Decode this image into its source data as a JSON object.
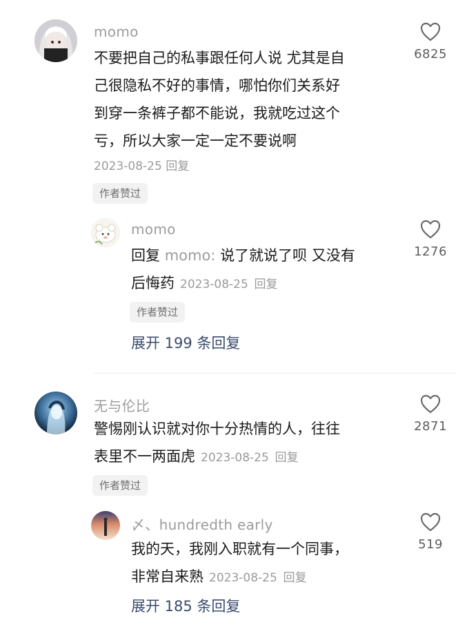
{
  "icons": {
    "like": "heart-outline-icon"
  },
  "colors": {
    "text": "#1a1a1a",
    "muted": "#9a9a9a",
    "link": "#3a4a6c",
    "badge_bg": "#f2f2f2"
  },
  "comments": [
    {
      "username": "momo",
      "text": "不要把自己的私事跟任何人说 尤其是自己很隐私不好的事情，哪怕你们关系好到穿一条裤子都不能说，我就吃过这个亏，所以大家一定一定不要说啊",
      "lines": [
        "不要把自己的私事跟任何人说 尤其是自",
        "己很隐私不好的事情，哪怕你们关系好",
        "到穿一条裤子都不能说，我就吃过这个",
        "亏，所以大家一定一定不要说啊"
      ],
      "date": "2023-08-25",
      "reply_label": "回复",
      "badge": "作者赞过",
      "likes": "6825",
      "reply": {
        "username": "momo",
        "prefix": "回复",
        "reply_to": "momo:",
        "line1": "说了就说了呗 又没有",
        "line2": "后悔药",
        "date": "2023-08-25",
        "reply_label": "回复",
        "badge": "作者赞过",
        "likes": "1276"
      },
      "expand": "展开 199 条回复"
    },
    {
      "username": "无与伦比",
      "line1": "警惕刚认识就对你十分热情的人，往往",
      "line2": "表里不一两面虎",
      "date": "2023-08-25",
      "reply_label": "回复",
      "badge": "作者赞过",
      "likes": "2871",
      "reply": {
        "username": "〆、hundredth early",
        "line1": "我的天，我刚入职就有一个同事，",
        "line2": "非常自来熟",
        "date": "2023-08-25",
        "reply_label": "回复",
        "likes": "519"
      },
      "expand": "展开 185 条回复"
    }
  ]
}
